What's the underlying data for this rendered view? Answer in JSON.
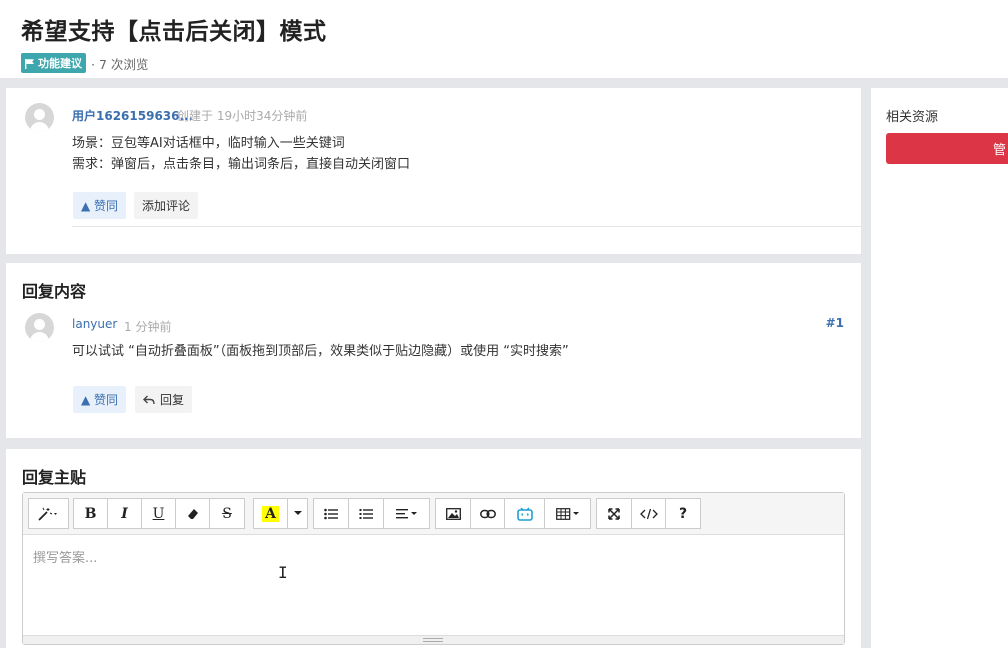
{
  "page": {
    "title": "希望支持【点击后关闭】模式",
    "tag": "功能建议",
    "views": "· 7 次浏览"
  },
  "post": {
    "author": "用户1626159636...",
    "created": "创建于 19小时34分钟前",
    "lines": [
      "场景：豆包等AI对话框中，临时输入一些关键词",
      "需求：弹窗后，点击条目，输出词条后，直接自动关闭窗口"
    ],
    "vote_label": "▲ 赞同",
    "comment_label": "添加评论"
  },
  "replies": {
    "section_title": "回复内容",
    "items": [
      {
        "author": "lanyuer",
        "time": "1 分钟前",
        "floor": "#1",
        "content": "可以试试 “自动折叠面板”（面板拖到顶部后，效果类似于贴边隐藏）或使用 “实时搜索”",
        "vote_label": "▲ 赞同",
        "reply_label": "回复"
      }
    ]
  },
  "reply_form": {
    "section_title": "回复主贴",
    "placeholder": "撰写答案..."
  },
  "toolbar": {
    "bold": "B",
    "italic": "I",
    "underline": "U",
    "strike": "S",
    "font_color": "A",
    "help": "?"
  },
  "sidebar": {
    "title": "相关资源",
    "button_label": "管"
  },
  "colors": {
    "tag": "#3ea7ad",
    "link": "#3b6fb0",
    "danger": "#dc3545",
    "highlight": "#ffff00"
  }
}
